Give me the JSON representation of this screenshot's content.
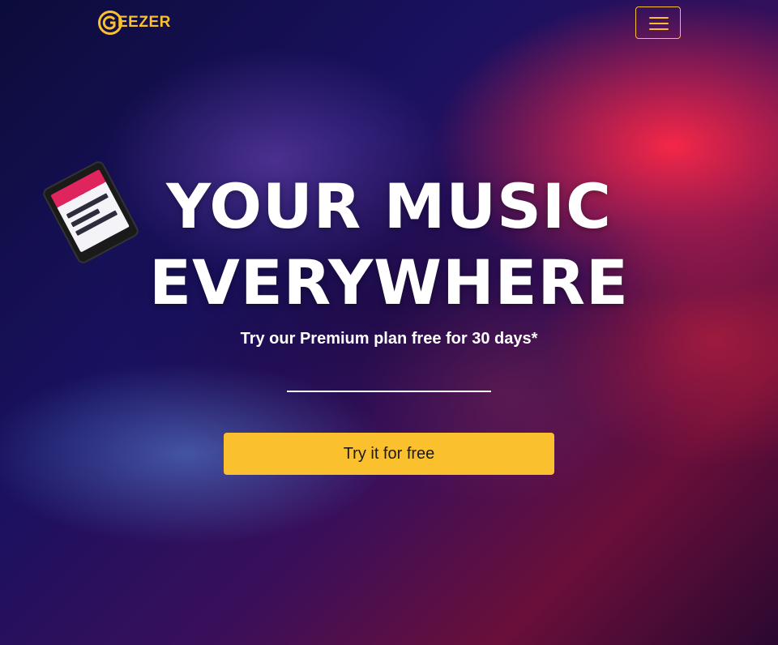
{
  "brand": {
    "name": "EEZER",
    "icon": "g-logo-icon",
    "color": "#fbc02d"
  },
  "navbar": {
    "toggler_icon": "hamburger-menu-icon"
  },
  "hero": {
    "headline_line1": "YOUR MUSIC",
    "headline_line2": "EVERYWHERE",
    "subline": "Try our Premium plan free for 30 days*",
    "cta_label": "Try it for free",
    "cta_color": "#fbc02d"
  }
}
